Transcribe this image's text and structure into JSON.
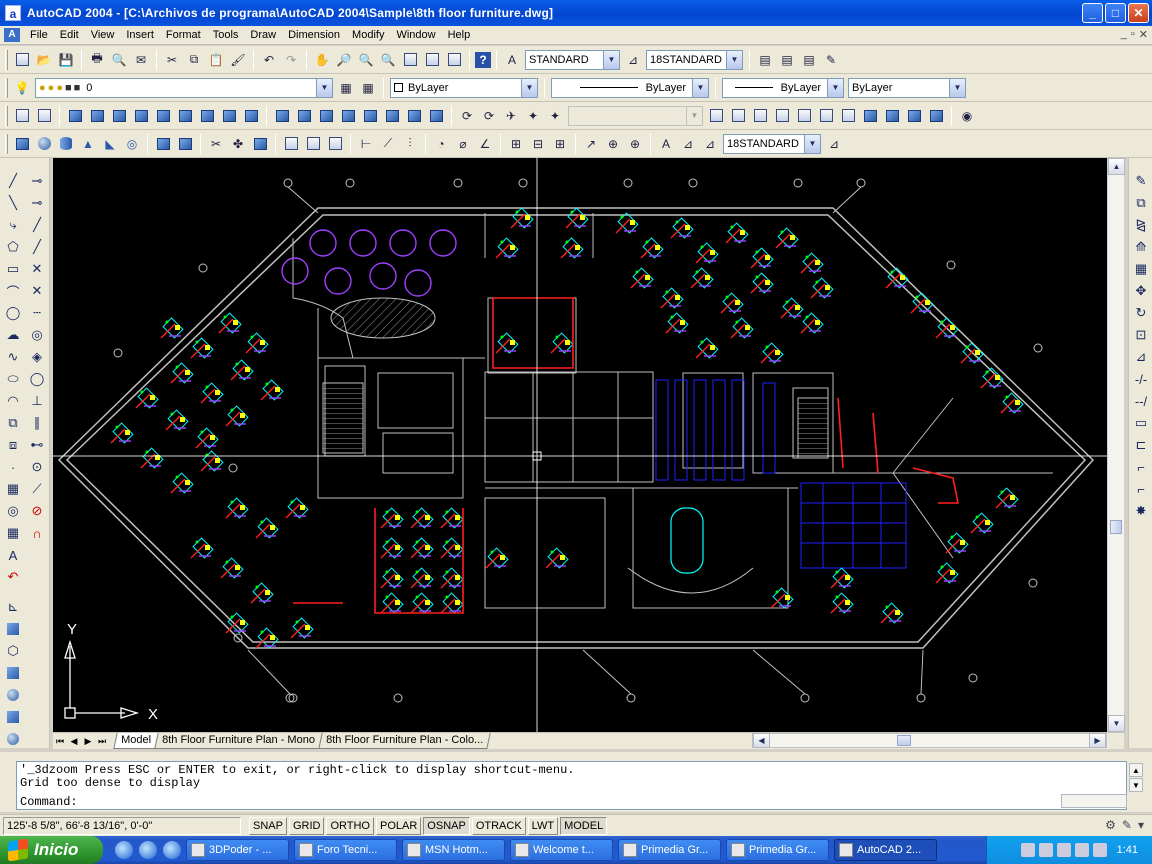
{
  "window": {
    "title": "AutoCAD 2004 - [C:\\Archivos de programa\\AutoCAD 2004\\Sample\\8th floor furniture.dwg]",
    "app_icon_letter": "a",
    "controls": {
      "minimize": "_",
      "maximize": "□",
      "close": "✕"
    }
  },
  "menubar": {
    "items": [
      "File",
      "Edit",
      "View",
      "Insert",
      "Format",
      "Tools",
      "Draw",
      "Dimension",
      "Modify",
      "Window",
      "Help"
    ],
    "mdi_controls": [
      "_",
      "▫",
      "✕"
    ]
  },
  "toolbars": {
    "text_style": "STANDARD",
    "dim_style": "18STANDARD",
    "layer": "0",
    "color": "ByLayer",
    "linetype": "ByLayer",
    "lineweight": "ByLayer",
    "plotstyle": "ByLayer",
    "dim_style_2": "18STANDARD"
  },
  "ucs": {
    "x_label": "X",
    "y_label": "Y"
  },
  "layout_tabs": {
    "nav": [
      "⏮",
      "◀",
      "▶",
      "⏭"
    ],
    "tabs": [
      "Model",
      "8th Floor Furniture Plan - Mono",
      "8th Floor Furniture Plan - Colo..."
    ],
    "active": "Model"
  },
  "command": {
    "history": [
      "'_3dzoom Press ESC or ENTER to exit, or right-click to display shortcut-menu.",
      "Grid too dense to display"
    ],
    "prompt": "Command:"
  },
  "status": {
    "coordinates": "125'-8 5/8\", 66'-8 13/16\", 0'-0\"",
    "toggles": [
      {
        "label": "SNAP",
        "on": false
      },
      {
        "label": "GRID",
        "on": false
      },
      {
        "label": "ORTHO",
        "on": false
      },
      {
        "label": "POLAR",
        "on": false
      },
      {
        "label": "OSNAP",
        "on": true
      },
      {
        "label": "OTRACK",
        "on": false
      },
      {
        "label": "LWT",
        "on": false
      },
      {
        "label": "MODEL",
        "on": true
      }
    ]
  },
  "taskbar": {
    "start_label": "Inicio",
    "tasks": [
      {
        "label": "3DPoder - ...",
        "active": false
      },
      {
        "label": "Foro Tecni...",
        "active": false
      },
      {
        "label": "MSN Hotm...",
        "active": false
      },
      {
        "label": "Welcome t...",
        "active": false
      },
      {
        "label": "Primedia Gr...",
        "active": false
      },
      {
        "label": "Primedia Gr...",
        "active": false
      },
      {
        "label": "AutoCAD 2...",
        "active": true
      }
    ],
    "clock": "1:41"
  },
  "colors": {
    "drawing_bg": "#000000",
    "wall": "#c0c0c0",
    "furniture": "#00ffff",
    "chair": "#ffff00",
    "partition": "#ff2020",
    "purple": "#a040ff",
    "blue": "#2020ff",
    "green": "#00ff00",
    "title_blue": "#0a5ee8"
  }
}
